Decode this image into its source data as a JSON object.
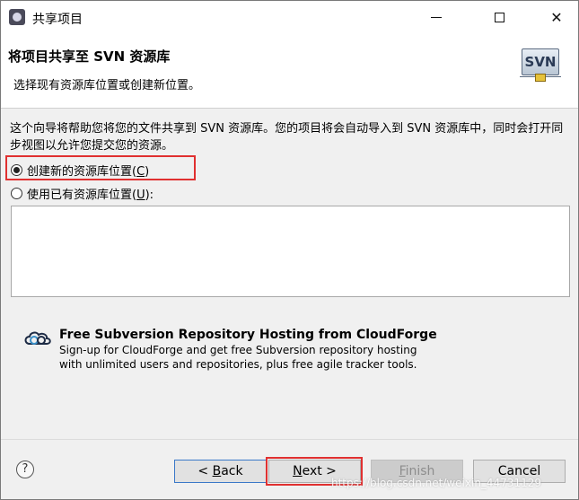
{
  "window": {
    "title": "共享项目"
  },
  "header": {
    "title": "将项目共享至 SVN 资源库",
    "subtitle": "选择现有资源库位置或创建新位置。",
    "logo_text": "SVN"
  },
  "intro_text": "这个向导将帮助您将您的文件共享到 SVN 资源库。您的项目将会自动导入到 SVN 资源库中，同时会打开同步视图以允许您提交您的资源。",
  "options": {
    "create_new": {
      "label": "创建新的资源库位置(",
      "mnemonic": "C",
      "suffix": ")",
      "selected": true
    },
    "use_existing": {
      "label": "使用已有资源库位置(",
      "mnemonic": "U",
      "suffix": "):",
      "selected": false
    }
  },
  "cloudforge": {
    "title": "Free Subversion Repository Hosting from CloudForge",
    "line1": "Sign-up for CloudForge and get free Subversion repository hosting",
    "line2": "with unlimited users and repositories, plus free agile tracker tools."
  },
  "buttons": {
    "help": "?",
    "back_prefix": "< ",
    "back_mnemonic": "B",
    "back_rest": "ack",
    "next_mnemonic": "N",
    "next_rest": "ext >",
    "finish_mnemonic": "F",
    "finish_rest": "inish",
    "cancel": "Cancel"
  },
  "watermark": "https://blog.csdn.net/weixin_44731129",
  "colors": {
    "highlight": "#e03030",
    "header_bg": "#ffffff",
    "dialog_bg": "#f0f0f0"
  }
}
